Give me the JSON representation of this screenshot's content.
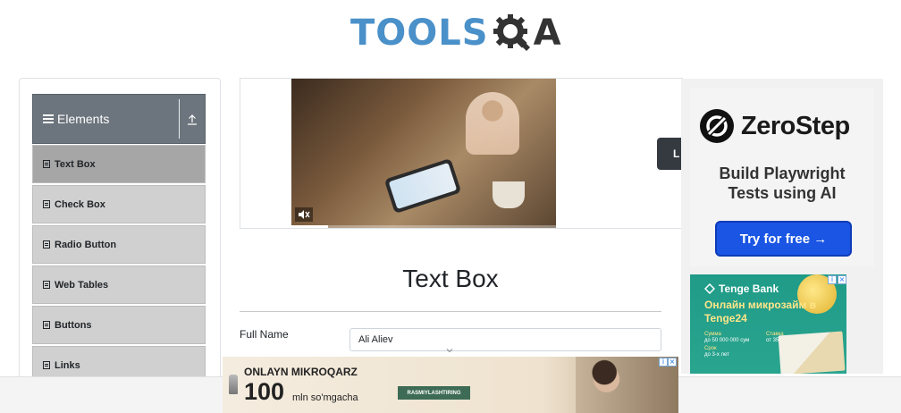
{
  "header": {
    "logo_text_left": "TOOLS",
    "logo_text_right": "A",
    "logo_icon": "gear-magnifier-icon"
  },
  "sidebar": {
    "group_title": "Elements",
    "group_icon": "hamburger-icon",
    "collapse_icon": "upload-icon",
    "items": [
      {
        "label": "Text Box",
        "active": true
      },
      {
        "label": "Check Box",
        "active": false
      },
      {
        "label": "Radio Button",
        "active": false
      },
      {
        "label": "Web Tables",
        "active": false
      },
      {
        "label": "Buttons",
        "active": false
      },
      {
        "label": "Links",
        "active": false
      }
    ]
  },
  "banner": {
    "button_label": "L",
    "mute_icon": "mute-icon",
    "video_progress": 0.14
  },
  "main": {
    "page_title": "Text Box",
    "full_name_label": "Full Name",
    "full_name_value": "Ali Aliev"
  },
  "ads": {
    "zerostep": {
      "brand": "ZeroStep",
      "tagline_line1": "Build Playwright",
      "tagline_line2": "Tests using AI",
      "cta": "Try for free →"
    },
    "tenge": {
      "brand": "Tenge Bank",
      "headline": "Онлайн микрозайм в Tenge24",
      "amount_key": "Сумма",
      "amount_val": "до 50 000 000 сум",
      "rate_key": "Ставка",
      "rate_val": "от 35.9% годовых",
      "term_key": "Срок",
      "term_val": "до 3-х лет"
    },
    "bottom": {
      "line1": "ONLAYN MIKROQARZ",
      "big": "100",
      "unit": "mln so'mgacha",
      "cta": "RASMIYLASHTIRING"
    }
  },
  "colors": {
    "logo_blue": "#4a90c9",
    "sidebar_header": "#6c757d",
    "menu_item": "#d0d0d0",
    "menu_item_active": "#a6a6a6",
    "zerostep_button": "#1a55e3",
    "tenge_green": "#2aa58f"
  }
}
